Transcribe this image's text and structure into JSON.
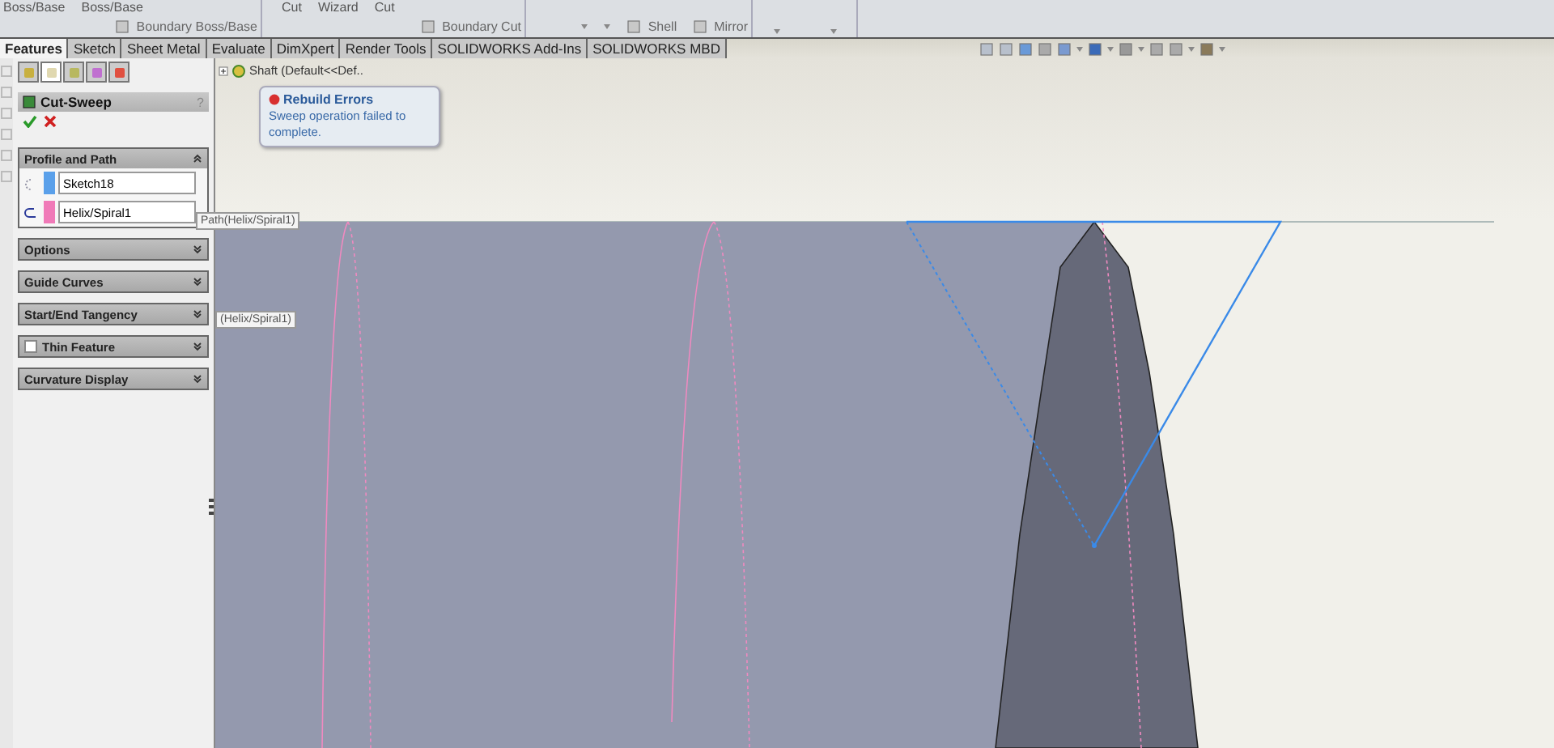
{
  "ribbon": {
    "groups": [
      {
        "top": [
          "Boss/Base",
          "Boss/Base"
        ],
        "buttons": [
          "Boundary Boss/Base"
        ]
      },
      {
        "top": [
          "Cut",
          "Wizard",
          "Cut"
        ],
        "buttons": [
          "Boundary Cut"
        ]
      },
      {
        "buttons": [
          "Shell",
          "Mirror"
        ]
      }
    ]
  },
  "tabs": [
    {
      "label": "Features",
      "selected": true
    },
    {
      "label": "Sketch",
      "selected": false
    },
    {
      "label": "Sheet Metal",
      "selected": false
    },
    {
      "label": "Evaluate",
      "selected": false
    },
    {
      "label": "DimXpert",
      "selected": false
    },
    {
      "label": "Render Tools",
      "selected": false
    },
    {
      "label": "SOLIDWORKS Add-Ins",
      "selected": false
    },
    {
      "label": "SOLIDWORKS MBD",
      "selected": false
    }
  ],
  "panel": {
    "tabs": [
      {
        "selected": false
      },
      {
        "selected": true
      },
      {
        "selected": false
      },
      {
        "selected": false
      },
      {
        "selected": false
      }
    ],
    "title": "Cut-Sweep",
    "help": "?",
    "sections": [
      {
        "kind": "plain",
        "title": "Profile and Path",
        "expanded": true,
        "fields": [
          {
            "value": "Sketch18",
            "color": "#5aa0ea"
          },
          {
            "value": "Helix/Spiral1",
            "color": "#f07ab8"
          }
        ]
      },
      {
        "kind": "plain",
        "title": "Options",
        "expanded": false
      },
      {
        "kind": "plain",
        "title": "Guide Curves",
        "expanded": false
      },
      {
        "kind": "plain",
        "title": "Start/End Tangency",
        "expanded": false
      },
      {
        "kind": "checkbox",
        "title": "Thin Feature",
        "expanded": false,
        "checked": false
      },
      {
        "kind": "plain",
        "title": "Curvature Display",
        "expanded": false
      }
    ]
  },
  "viewport": {
    "tree_item": "Shaft (Default<<Def..",
    "error": {
      "title": "Rebuild Errors",
      "message": "Sweep operation failed to complete."
    },
    "tooltips": [
      "Path(Helix/Spiral1)",
      "(Helix/Spiral1)"
    ]
  }
}
